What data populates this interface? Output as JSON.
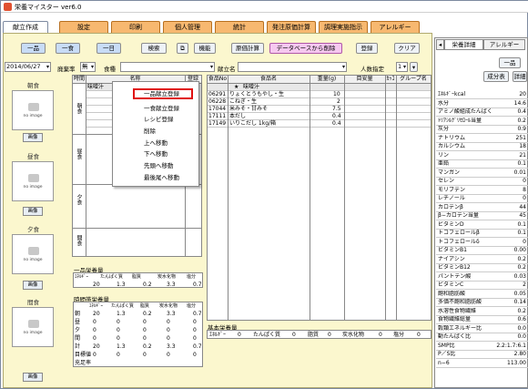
{
  "window": {
    "title": "栄養マイスター ver6.0"
  },
  "tabs": [
    "献立作成",
    "設定",
    "印刷",
    "個人管理",
    "統計",
    "発注原価計算",
    "調理実施指示",
    "アレルギー"
  ],
  "toolbar": {
    "one_item": "一品",
    "one_meal": "一食",
    "one_day": "一日",
    "search": "検索",
    "copy_icon": "copy-icon",
    "function": "機能",
    "cost_calc": "原価計算",
    "delete_from_db": "データベースから削除",
    "register": "登録",
    "clear": "クリア"
  },
  "filters": {
    "date": "2014/06/27",
    "waste_label": "廃棄率",
    "waste_value": "無",
    "meal_label": "食種",
    "meal_value": "",
    "menu_name_label": "献立名",
    "people_label": "人数指定",
    "people_value": "1"
  },
  "left_meals": [
    {
      "title": "朝食",
      "image_caption": "no image",
      "button": "画像"
    },
    {
      "title": "昼食",
      "image_caption": "no image",
      "button": "画像"
    },
    {
      "title": "夕食",
      "image_caption": "no image",
      "button": "画像"
    },
    {
      "title": "間食",
      "image_caption": "no image",
      "button": "画像"
    }
  ],
  "menu_grid": {
    "h_time": "時間",
    "h_name": "名称",
    "h_reg": "登録",
    "first_row": "味噌汁",
    "sections": [
      "朝食",
      "昼食",
      "夕食",
      "間食"
    ]
  },
  "food_grid": {
    "headers": [
      "食品No",
      "食品名",
      "重量(g)",
      "目安量",
      "ｶｯｺ",
      "グループ名"
    ],
    "title_row": {
      "mark": "★",
      "name": "味噌汁"
    },
    "rows": [
      {
        "no": "06291",
        "name": "りょくとうもやし・生",
        "weight": "10"
      },
      {
        "no": "06228",
        "name": "こねぎ・生",
        "weight": "2"
      },
      {
        "no": "17044",
        "name": "米みそ・甘みそ",
        "weight": "7.5"
      },
      {
        "no": "17111",
        "name": "本だし",
        "weight": "0.4"
      },
      {
        "no": "17149",
        "name": "いりこだし 1kg/箱",
        "weight": "0.4"
      }
    ]
  },
  "context_menu": [
    "一品献立登録",
    "一食献立登録",
    "レシピ登録",
    "削除",
    "上へ移動",
    "下へ移動",
    "先頭へ移動",
    "最後尾へ移動"
  ],
  "one_item_summary": {
    "title": "一品栄養量",
    "headers": [
      "ｴﾈﾙｷﾞｰ",
      "たんぱく質",
      "脂質",
      "炭水化物",
      "塩分"
    ],
    "values": [
      "20",
      "1.3",
      "0.2",
      "3.3",
      "0.7"
    ]
  },
  "time_summary": {
    "title": "時間帯栄養量",
    "headers": [
      "ｴﾈﾙｷﾞｰ",
      "たんぱく質",
      "脂質",
      "炭水化物",
      "塩分"
    ],
    "rows": [
      {
        "label": "朝",
        "values": [
          "20",
          "1.3",
          "0.2",
          "3.3",
          "0.7"
        ]
      },
      {
        "label": "昼",
        "values": [
          "0",
          "0",
          "0",
          "0",
          "0"
        ]
      },
      {
        "label": "夕",
        "values": [
          "0",
          "0",
          "0",
          "0",
          "0"
        ]
      },
      {
        "label": "間",
        "values": [
          "0",
          "0",
          "0",
          "0",
          "0"
        ]
      },
      {
        "label": "計",
        "values": [
          "20",
          "1.3",
          "0.2",
          "3.3",
          "0.7"
        ]
      },
      {
        "label": "目標値",
        "values": [
          "0",
          "0",
          "0",
          "0",
          "0"
        ]
      },
      {
        "label": "充足率",
        "values": [
          "",
          "",
          "",
          "",
          ""
        ]
      }
    ]
  },
  "basic_summary": {
    "title": "基本栄養量",
    "items": [
      "ｴﾈﾙｷﾞｰ",
      "0",
      "たんぱく質",
      "0",
      "脂質",
      "0",
      "炭水化物",
      "0",
      "塩分",
      "0"
    ]
  },
  "right_pane": {
    "tabs": [
      "栄養詳細",
      "アレルギー"
    ],
    "btn_one": "一品",
    "btn_comp": "成分表",
    "btn_detail": "詳細",
    "nutrients": [
      {
        "n": "ｴﾈﾙｷﾞｰkcal",
        "v": "20"
      },
      {
        "n": "水分",
        "v": "14.6"
      },
      {
        "n": "アミノ酸組成たんぱく",
        "v": "0.4"
      },
      {
        "n": "ﾄﾘｱｼﾙｸﾞﾘｾﾛｰﾙ当量",
        "v": "0.2"
      },
      {
        "n": "灰分",
        "v": "0.9"
      },
      {
        "n": "ナトリウム",
        "v": "251"
      },
      {
        "n": "カルシウム",
        "v": "18"
      },
      {
        "n": "リン",
        "v": "21"
      },
      {
        "n": "亜鉛",
        "v": "0.1"
      },
      {
        "n": "マンガン",
        "v": "0.01"
      },
      {
        "n": "セレン",
        "v": "0"
      },
      {
        "n": "モリブデン",
        "v": "8"
      },
      {
        "n": "レチノール",
        "v": "0"
      },
      {
        "n": "カロテンβ",
        "v": "44"
      },
      {
        "n": "β−カロテン当量",
        "v": "45"
      },
      {
        "n": "ビタミンD",
        "v": "0.1"
      },
      {
        "n": "トコフェロールβ",
        "v": "0.1"
      },
      {
        "n": "トコフェロールδ",
        "v": "0"
      },
      {
        "n": "ビタミンB1",
        "v": "0.00"
      },
      {
        "n": "ナイアシン",
        "v": "0.2"
      },
      {
        "n": "ビタミンB12",
        "v": "0.2"
      },
      {
        "n": "パントテン酸",
        "v": "0.03"
      },
      {
        "n": "ビタミンC",
        "v": "2"
      },
      {
        "n": "飽和脂肪酸",
        "v": "0.05"
      },
      {
        "n": "多価不飽和脂肪酸",
        "v": "0.14"
      },
      {
        "n": "水溶性食物繊維",
        "v": "0.2"
      },
      {
        "n": "食物繊維総量",
        "v": "0.6"
      },
      {
        "n": "穀類エネルギー比",
        "v": "0.0"
      },
      {
        "n": "動たんぱく比",
        "v": "0.0"
      },
      {
        "n": "SMP比",
        "v": "2.2:1.7:6.1"
      },
      {
        "n": "P／S比",
        "v": "2.80"
      },
      {
        "n": "n−6",
        "v": "113.00"
      }
    ]
  }
}
